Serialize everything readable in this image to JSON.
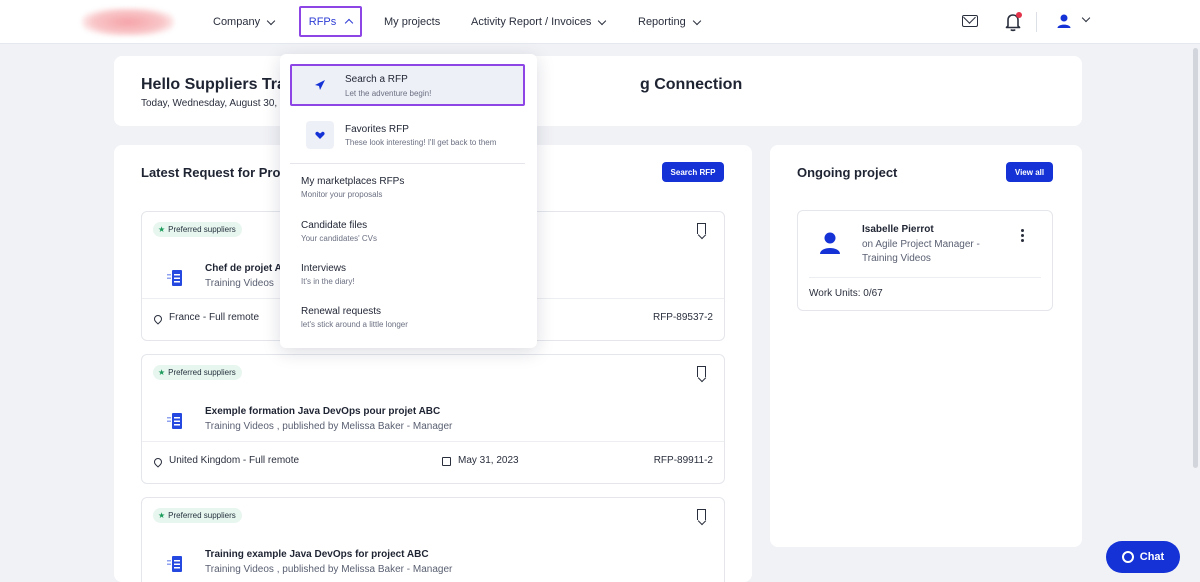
{
  "nav": {
    "items": [
      {
        "label": "Company"
      },
      {
        "label": "RFPs"
      },
      {
        "label": "My projects"
      },
      {
        "label": "Activity Report / Invoices"
      },
      {
        "label": "Reporting"
      }
    ]
  },
  "hello": {
    "title_start": "Hello Suppliers Tra",
    "title_end": "g Connection",
    "date": "Today, Wednesday, August 30,"
  },
  "latest": {
    "title": "Latest Request for Prop",
    "search_button": "Search RFP",
    "rfps": [
      {
        "badge": "Preferred suppliers",
        "title": "Chef de projet A",
        "subtitle": "Training Videos",
        "location": "France - Full remote",
        "date": "",
        "ref": "RFP-89537-2"
      },
      {
        "badge": "Preferred suppliers",
        "title": "Exemple formation Java DevOps pour projet ABC",
        "subtitle": "Training Videos , published by Melissa Baker - Manager",
        "location": "United Kingdom - Full remote",
        "date": "May 31, 2023",
        "ref": "RFP-89911-2"
      },
      {
        "badge": "Preferred suppliers",
        "title": "Training example Java DevOps for project ABC",
        "subtitle": "Training Videos , published by Melissa Baker - Manager",
        "location": "",
        "date": "",
        "ref": ""
      }
    ]
  },
  "ongoing": {
    "title": "Ongoing project",
    "view_all": "View all",
    "project": {
      "name": "Isabelle Pierrot",
      "role": "on Agile Project Manager - Training Videos",
      "units": "Work Units: 0/67"
    }
  },
  "menu": {
    "items": [
      {
        "label": "Search a RFP",
        "desc": "Let the adventure begin!"
      },
      {
        "label": "Favorites RFP",
        "desc": "These look interesting! I'll get back to them"
      },
      {
        "label": "My marketplaces RFPs",
        "desc": "Monitor your proposals"
      },
      {
        "label": "Candidate files",
        "desc": "Your candidates' CVs"
      },
      {
        "label": "Interviews",
        "desc": "It's in the diary!"
      },
      {
        "label": "Renewal requests",
        "desc": "let's stick around a little longer"
      }
    ]
  },
  "chat": {
    "label": "Chat"
  },
  "colors": {
    "accent": "#1432d6",
    "highlight": "#8d45e6",
    "notification": "#e2334a",
    "badge_bg": "#e7f6ee"
  },
  "icons": [
    "mail-icon",
    "bell-icon",
    "user-icon",
    "bookmark-icon",
    "document-icon",
    "location-icon",
    "calendar-icon",
    "kebab-icon",
    "send-icon",
    "heart-icon",
    "chat-icon"
  ]
}
